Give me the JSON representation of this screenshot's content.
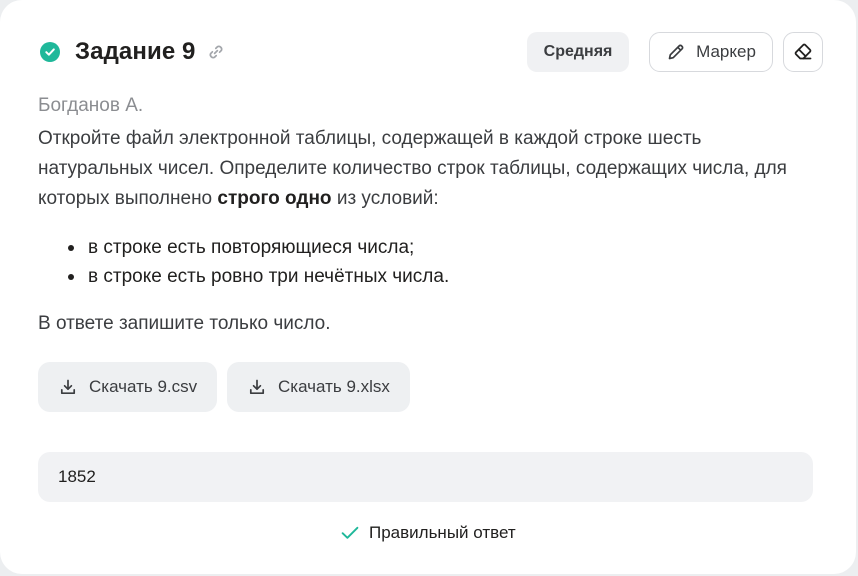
{
  "task": {
    "title": "Задание 9",
    "difficulty": "Средняя",
    "marker_label": "Маркер",
    "author": "Богданов А.",
    "text_part1": "Откройте файл электронной таблицы, содержащей в каждой строке шесть натуральных чисел. Определите количество строк таблицы, содержащих числа, для которых выполнено ",
    "text_bold": "строго одно",
    "text_part2": " из условий:",
    "conditions": [
      "в строке есть повторяющиеся числа;",
      "в строке есть ровно три нечётных числа."
    ],
    "answer_note": "В ответе запишите только число."
  },
  "downloads": [
    {
      "label": "Скачать 9.csv",
      "icon": "download-icon"
    },
    {
      "label": "Скачать 9.xlsx",
      "icon": "download-icon"
    }
  ],
  "answer": {
    "value": "1852",
    "status": "Правильный ответ"
  },
  "colors": {
    "success": "#1fb89a",
    "button_bg": "#eef0f2",
    "card_bg": "#ffffff"
  },
  "icons": {
    "status": "check-circle-icon",
    "link": "link-icon",
    "marker": "pencil-icon",
    "eraser": "eraser-icon",
    "result": "checkmark-icon"
  }
}
